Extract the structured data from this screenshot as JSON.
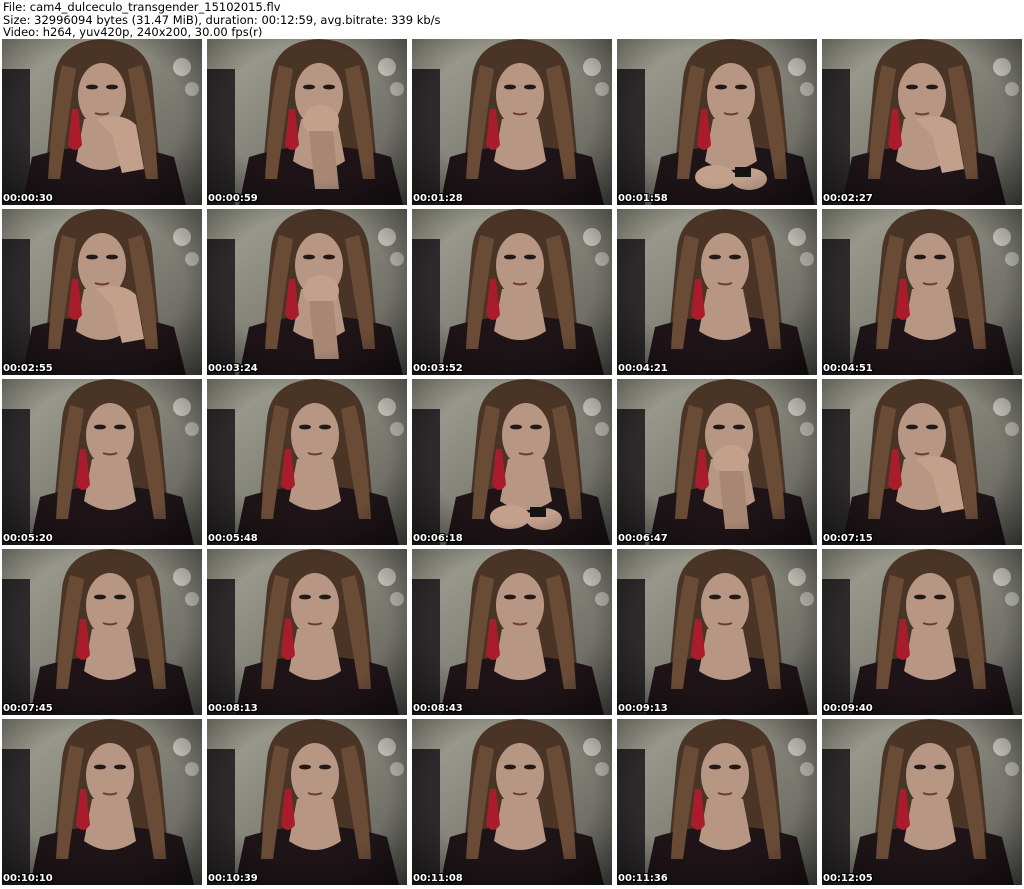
{
  "header": {
    "file_line": "File: cam4_dulceculo_transgender_15102015.flv",
    "size_line": "Size: 32996094 bytes (31.47 MiB), duration: 00:12:59, avg.bitrate: 339 kb/s",
    "video_line": "Video: h264, yuv420p, 240x200, 30.00 fps(r)"
  },
  "thumbnails": [
    {
      "timestamp": "00:00:30",
      "pose": "hand-chin"
    },
    {
      "timestamp": "00:00:59",
      "pose": "hand-mouth"
    },
    {
      "timestamp": "00:01:28",
      "pose": "neutral"
    },
    {
      "timestamp": "00:01:58",
      "pose": "phone"
    },
    {
      "timestamp": "00:02:27",
      "pose": "hand-chin"
    },
    {
      "timestamp": "00:02:55",
      "pose": "hand-chin"
    },
    {
      "timestamp": "00:03:24",
      "pose": "hand-mouth"
    },
    {
      "timestamp": "00:03:52",
      "pose": "neutral"
    },
    {
      "timestamp": "00:04:21",
      "pose": "neutral"
    },
    {
      "timestamp": "00:04:51",
      "pose": "neutral"
    },
    {
      "timestamp": "00:05:20",
      "pose": "neutral"
    },
    {
      "timestamp": "00:05:48",
      "pose": "neutral"
    },
    {
      "timestamp": "00:06:18",
      "pose": "phone"
    },
    {
      "timestamp": "00:06:47",
      "pose": "hand-mouth"
    },
    {
      "timestamp": "00:07:15",
      "pose": "hand-chin"
    },
    {
      "timestamp": "00:07:45",
      "pose": "neutral"
    },
    {
      "timestamp": "00:08:13",
      "pose": "neutral"
    },
    {
      "timestamp": "00:08:43",
      "pose": "neutral"
    },
    {
      "timestamp": "00:09:13",
      "pose": "neutral"
    },
    {
      "timestamp": "00:09:40",
      "pose": "neutral"
    },
    {
      "timestamp": "00:10:10",
      "pose": "neutral"
    },
    {
      "timestamp": "00:10:39",
      "pose": "neutral"
    },
    {
      "timestamp": "00:11:08",
      "pose": "neutral"
    },
    {
      "timestamp": "00:11:36",
      "pose": "neutral"
    },
    {
      "timestamp": "00:12:05",
      "pose": "neutral"
    }
  ],
  "colors": {
    "page_background": "#ffffff",
    "header_text": "#000000",
    "timestamp_text": "#ffffff",
    "timestamp_outline": "#000000",
    "wall": "#8e8e82",
    "hair": "#4a3426",
    "skin": "#b79684",
    "top": "#1e1418",
    "earring": "#a81c2c"
  }
}
